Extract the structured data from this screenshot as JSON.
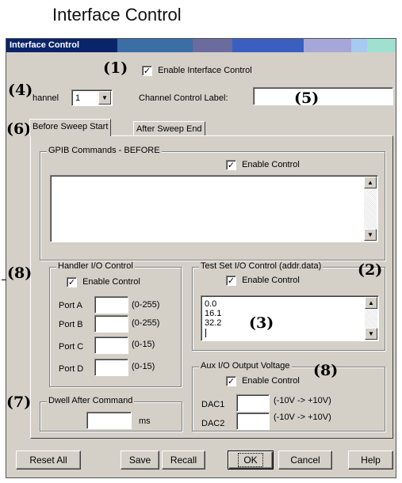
{
  "figure_title": "Interface Control",
  "window": {
    "title": "Interface Control",
    "titlebar_colors": [
      "#0a246a",
      "#3a6ea5",
      "#6b6b9e",
      "#3a5fc0",
      "#a6caf0",
      "#8fb8d8",
      "#9fe0d0"
    ]
  },
  "callouts": {
    "c1": "(1)",
    "c2": "(2)",
    "c3": "(3)",
    "c4": "(4)",
    "c5": "(5)",
    "c6": "(6)",
    "c7": "(7)",
    "c8a": "(8)",
    "c8b": "(8)"
  },
  "top": {
    "enable_interface_control": "Enable Interface Control",
    "enable_checked": "✓",
    "channel_label": "hannel",
    "channel_value": "1",
    "channel_control_label": "Channel Control Label:",
    "channel_control_value": ""
  },
  "tabs": [
    "Before Sweep Start",
    "After Sweep End"
  ],
  "gpib": {
    "title": "GPIB Commands - BEFORE",
    "enable_label": "Enable Control",
    "checked": "✓"
  },
  "handler": {
    "title": "Handler I/O Control",
    "enable_label": "Enable Control",
    "checked": "✓",
    "ports": [
      {
        "label": "Port A",
        "range": "(0-255)"
      },
      {
        "label": "Port B",
        "range": "(0-255)"
      },
      {
        "label": "Port C",
        "range": "(0-15)"
      },
      {
        "label": "Port D",
        "range": "(0-15)"
      }
    ]
  },
  "testset": {
    "title": "Test Set I/O Control (addr.data)",
    "enable_label": "Enable Control",
    "checked": "✓",
    "lines": [
      "0.0",
      "16.1",
      "32.2"
    ]
  },
  "aux": {
    "title": "Aux I/O Output Voltage",
    "enable_label": "Enable Control",
    "checked": "✓",
    "dac1": "DAC1",
    "dac1_range": "(-10V -> +10V)",
    "dac2": "DAC2",
    "dac2_range": "(-10V -> +10V)"
  },
  "dwell": {
    "title": "Dwell After Command",
    "unit": "ms"
  },
  "buttons": {
    "reset_all": "Reset All",
    "save": "Save",
    "recall": "Recall",
    "ok": "OK",
    "cancel": "Cancel",
    "help": "Help"
  },
  "icons": {
    "dropdown": "▼",
    "scroll_up": "▲",
    "scroll_down": "▼"
  }
}
